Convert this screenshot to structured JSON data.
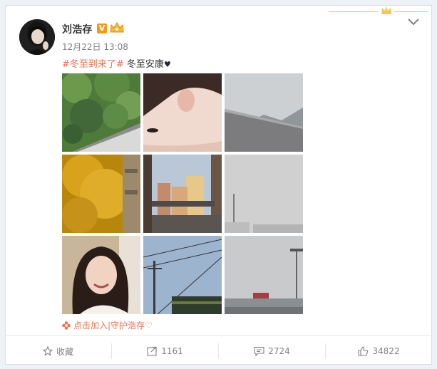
{
  "post": {
    "author": "刘浩存",
    "verified_badge": "V",
    "time": "12月22日 13:08",
    "topic": "#冬至到来了#",
    "body": " 冬至安康",
    "heart": "♥",
    "fan_link": "点击加入|守护浩存♡"
  },
  "actions": {
    "favorite": "收藏",
    "repost": "1161",
    "comment": "2724",
    "like": "34822"
  },
  "icons": [
    "crown-icon",
    "chevron-down-icon",
    "verified-icon",
    "member-crown-icon",
    "flower-icon",
    "star-icon",
    "share-icon",
    "comment-icon",
    "thumbs-up-icon"
  ],
  "colors": {
    "topic": "#eb7350",
    "verified": "#f39a17",
    "crown": "#f3c94e"
  },
  "photos": [
    "green-foliage-photo",
    "face-closeup-photo",
    "grey-sky-wall-photo",
    "yellow-ginkgo-tree-photo",
    "city-buildings-photo",
    "hazy-sky-photo",
    "smiling-portrait-photo",
    "power-lines-photo",
    "overpass-photo"
  ]
}
